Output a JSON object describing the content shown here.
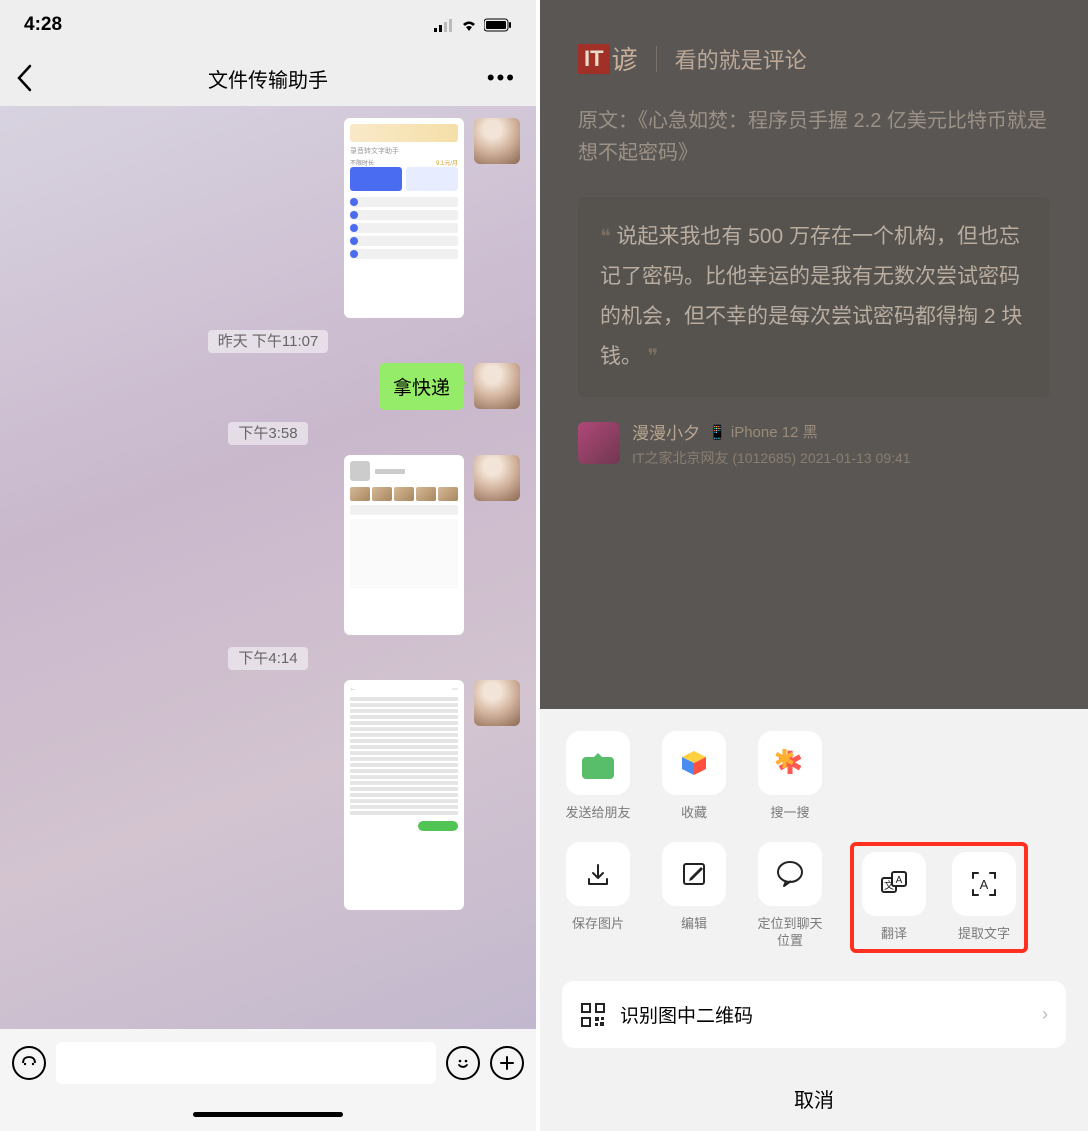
{
  "left": {
    "status_time": "4:28",
    "nav_title": "文件传输助手",
    "timestamps": {
      "t1": "昨天 下午11:07",
      "t2": "下午3:58",
      "t3": "下午4:14"
    },
    "bubble_text": "拿快递",
    "mock1_title": "录音转文字助手",
    "mock1_sub": "不限时长",
    "mock1_price": "9.1元/月"
  },
  "right": {
    "brand_it": "IT",
    "brand_cn": "谚",
    "brand_tag": "看的就是评论",
    "orig_prefix": "原文：",
    "orig_title": "《心急如焚：程序员手握 2.2 亿美元比特币就是想不起密码》",
    "comment": "说起来我也有 500 万存在一个机构，但也忘记了密码。比他幸运的是我有无数次尝试密码的机会，但不幸的是每次尝试密码都得掏 2 块钱。",
    "commenter_name": "漫漫小夕",
    "commenter_phone": "iPhone 12 黑",
    "commenter_sub": "IT之家北京网友 (1012685) 2021-01-13 09:41",
    "actions_top": {
      "send": "发送给朋友",
      "fav": "收藏",
      "search": "搜一搜"
    },
    "actions_bottom": {
      "save": "保存图片",
      "edit": "编辑",
      "locate": "定位到聊天位置",
      "translate": "翻译",
      "ocr": "提取文字"
    },
    "qr_text": "识别图中二维码",
    "cancel": "取消"
  }
}
